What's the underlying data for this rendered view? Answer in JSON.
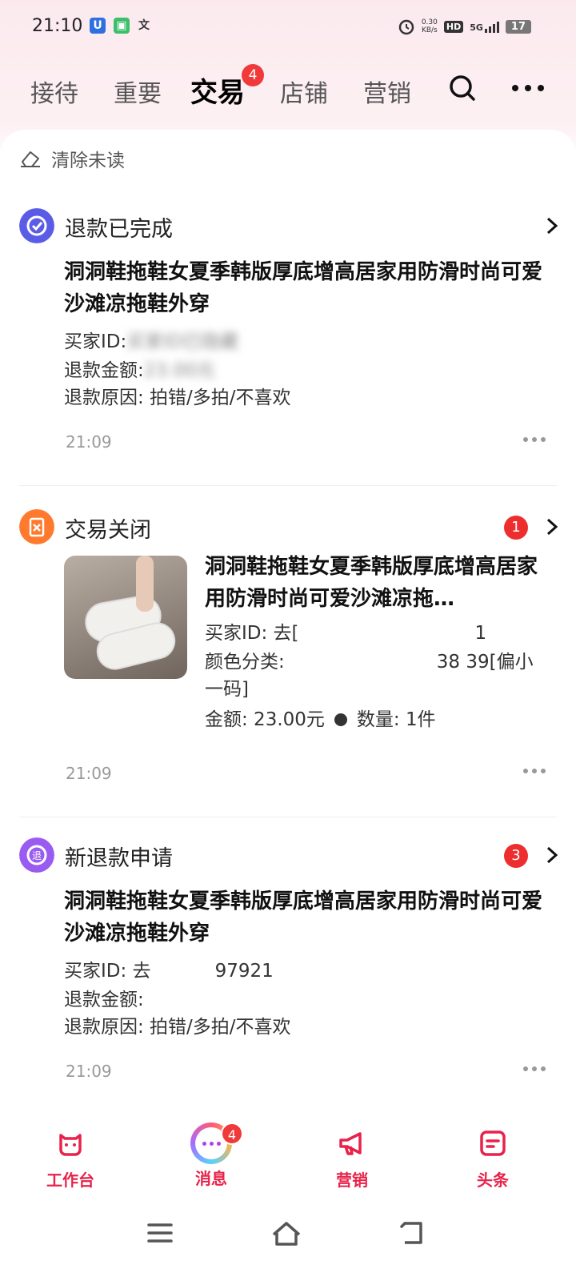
{
  "status_bar": {
    "time": "21:10",
    "net_speed_value": "0.30",
    "net_speed_unit": "KB/s",
    "hd": "HD",
    "network": "5G",
    "battery": "17"
  },
  "top_tabs": {
    "tabs": [
      "接待",
      "重要",
      "交易",
      "店铺",
      "营销"
    ],
    "active_index": 2,
    "trade_badge": "4"
  },
  "clear_unread": "清除未读",
  "messages": [
    {
      "type": "退款已完成",
      "title": "洞洞鞋拖鞋女夏季韩版厚底增高居家用防滑时尚可爱沙滩凉拖鞋外穿",
      "buyer_label": "买家ID:",
      "buyer_value": "买家ID已隐藏",
      "amount_label": "退款金额:",
      "amount_value": "23.00元",
      "reason": "退款原因: 拍错/多拍/不喜欢",
      "time": "21:09"
    },
    {
      "type": "交易关闭",
      "badge": "1",
      "title": "洞洞鞋拖鞋女夏季韩版厚底增高居家用防滑时尚可爱沙滩凉拖…",
      "buyer": "买家ID: 去[",
      "buyer_tail": "1",
      "color_prefix": "颜色分类:",
      "color_suffix": "38 39[偏小一码]",
      "amount": "金额: 23.00元",
      "quantity": "数量: 1件",
      "time": "21:09"
    },
    {
      "type": "新退款申请",
      "badge": "3",
      "title": "洞洞鞋拖鞋女夏季韩版厚底增高居家用防滑时尚可爱沙滩凉拖鞋外穿",
      "buyer_prefix": "买家ID: 去",
      "buyer_suffix": "97921",
      "amount_label": "退款金额:",
      "reason": "退款原因: 拍错/多拍/不喜欢",
      "time": "21:09"
    }
  ],
  "bottom_nav": {
    "items": [
      "工作台",
      "消息",
      "营销",
      "头条"
    ],
    "message_badge": "4",
    "accent": "#e8224a"
  },
  "colors": {
    "refund_done_icon": "#5b5ce6",
    "trade_closed_icon": "#ff7a2e",
    "new_refund_icon": "#9a5bf0",
    "badge_red": "#ee2e2e"
  }
}
